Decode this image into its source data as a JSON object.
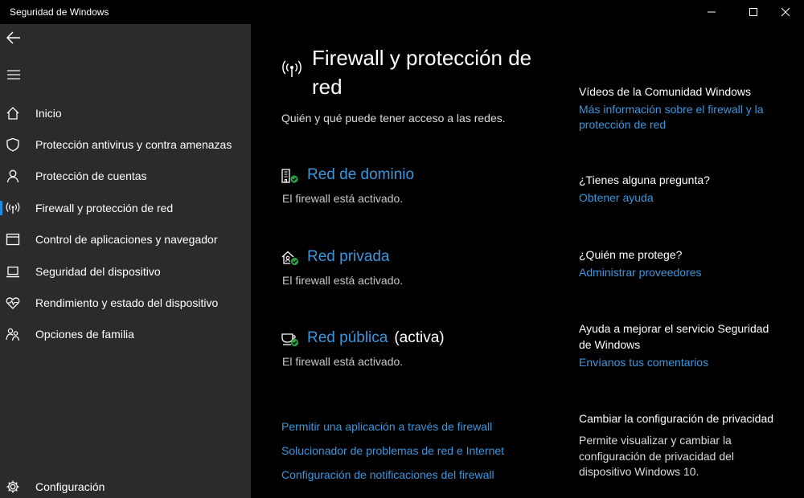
{
  "window": {
    "title": "Seguridad de Windows",
    "controls": [
      "minimize",
      "maximize",
      "close"
    ]
  },
  "sidebar": {
    "back_icon": "back-arrow-icon",
    "menu_icon": "hamburger-icon",
    "items": [
      {
        "label": "Inicio",
        "icon": "home-icon"
      },
      {
        "label": "Protección antivirus y contra amenazas",
        "icon": "shield-icon"
      },
      {
        "label": "Protección de cuentas",
        "icon": "person-icon"
      },
      {
        "label": "Firewall y protección de red",
        "icon": "antenna-icon",
        "selected": true
      },
      {
        "label": "Control de aplicaciones y navegador",
        "icon": "browser-window-icon"
      },
      {
        "label": "Seguridad del dispositivo",
        "icon": "laptop-icon"
      },
      {
        "label": "Rendimiento y estado del dispositivo",
        "icon": "heart-pulse-icon"
      },
      {
        "label": "Opciones de familia",
        "icon": "family-icon"
      }
    ],
    "settings": {
      "label": "Configuración",
      "icon": "gear-icon"
    }
  },
  "main": {
    "title": "Firewall y protección de red",
    "subtitle": "Quién y qué puede tener acceso a las redes.",
    "networks": [
      {
        "name": "Red de dominio",
        "status": "El firewall está activado.",
        "icon": "domain-network-icon"
      },
      {
        "name": "Red privada",
        "status": "El firewall está activado.",
        "icon": "private-network-icon"
      },
      {
        "name": "Red pública",
        "active_label": "(activa)",
        "status": "El firewall está activado.",
        "icon": "public-network-icon"
      }
    ],
    "links": [
      "Permitir una aplicación a través de firewall",
      "Solucionador de problemas de red e Internet",
      "Configuración de notificaciones del firewall"
    ]
  },
  "side": {
    "community": {
      "heading": "Vídeos de la Comunidad Windows",
      "link": "Más información sobre el firewall y la protección de red"
    },
    "question": {
      "heading": "¿Tienes alguna pregunta?",
      "link": "Obtener ayuda"
    },
    "protect": {
      "heading": "¿Quién me protege?",
      "link": "Administrar proveedores"
    },
    "improve": {
      "heading": "Ayuda a mejorar el servicio Seguridad de Windows",
      "link": "Envíanos tus comentarios"
    },
    "privacy": {
      "heading": "Cambiar la configuración de privacidad",
      "text": "Permite visualizar y cambiar la configuración de privacidad del dispositivo Windows 10."
    }
  },
  "colors": {
    "accent": "#3a96dd",
    "sidebar_bg": "#2b2b2b",
    "main_bg": "#000000",
    "selection_bar": "#1e88e5",
    "status_green": "#2ea043"
  }
}
